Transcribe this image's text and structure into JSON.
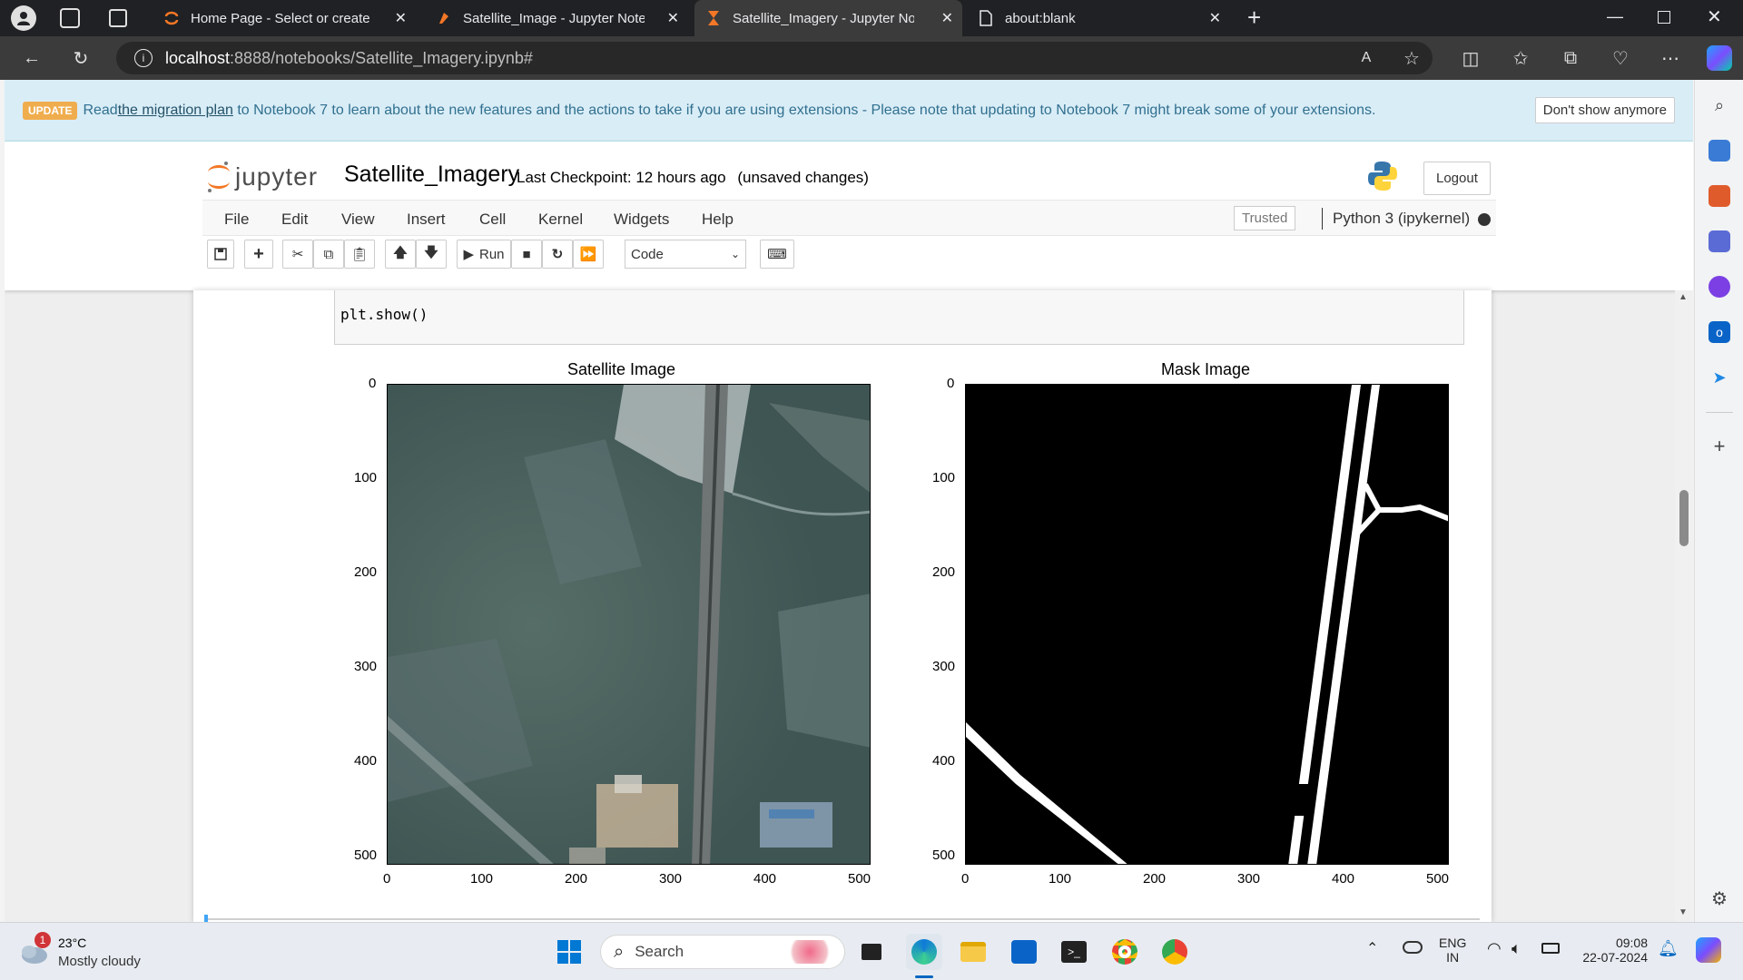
{
  "browser": {
    "tabs": [
      {
        "label": "Home Page - Select or create a n",
        "active": false
      },
      {
        "label": "Satellite_Image - Jupyter Notebo",
        "active": false
      },
      {
        "label": "Satellite_Imagery - Jupyter Note",
        "active": true
      },
      {
        "label": "about:blank",
        "active": false
      }
    ],
    "url_host": "localhost",
    "url_path": ":8888/notebooks/Satellite_Imagery.ipynb#"
  },
  "banner": {
    "badge": "UPDATE",
    "text_before": "Read ",
    "link": "the migration plan",
    "text_after": " to Notebook 7 to learn about the new features and the actions to take if you are using extensions - Please note that updating to Notebook 7 might break some of your extensions.",
    "dismiss": "Don't show anymore"
  },
  "header": {
    "logo_text": "jupyter",
    "notebook_title": "Satellite_Imagery",
    "checkpoint": "Last Checkpoint: 12 hours ago",
    "unsaved": "(unsaved changes)",
    "logout": "Logout"
  },
  "menubar": {
    "items": [
      "File",
      "Edit",
      "View",
      "Insert",
      "Cell",
      "Kernel",
      "Widgets",
      "Help"
    ],
    "trusted": "Trusted",
    "kernel": "Python 3 (ipykernel)"
  },
  "toolbar": {
    "run_label": "Run",
    "cell_type": "Code"
  },
  "cell": {
    "code": "plt.show()"
  },
  "plots": {
    "left_title": "Satellite Image",
    "right_title": "Mask Image",
    "ytick_labels": [
      "0",
      "100",
      "200",
      "300",
      "400",
      "500"
    ],
    "xtick_labels": [
      "0",
      "100",
      "200",
      "300",
      "400",
      "500"
    ]
  },
  "taskbar": {
    "weather_temp": "23°C",
    "weather_desc": "Mostly cloudy",
    "weather_badge": "1",
    "search": "Search",
    "lang_top": "ENG",
    "lang_bottom": "IN",
    "time": "09:08",
    "date": "22-07-2024"
  },
  "colors": {
    "jupyter_orange": "#F37726",
    "banner_bg": "#d9edf7",
    "banner_badge": "#f0ad4e",
    "browser_dark": "#202124"
  }
}
